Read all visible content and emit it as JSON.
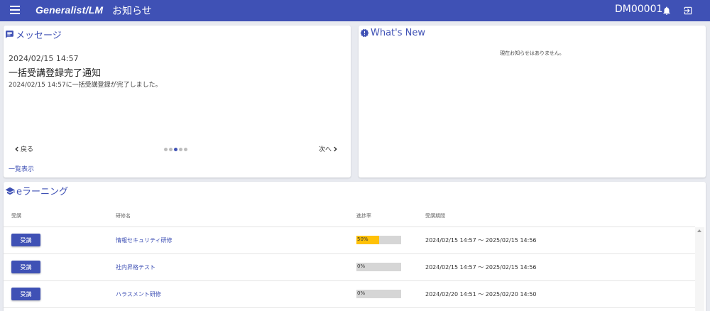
{
  "header": {
    "brand": "Generalist/LM",
    "page_title": "お知らせ",
    "user_id": "DM00001",
    "bar_color": "#3f51b5",
    "icons": [
      "menu-icon",
      "bell-icon",
      "logout-icon"
    ]
  },
  "message_card": {
    "title": "メッセージ",
    "icon": "message-icon",
    "date": "2024/02/15 14:57",
    "subject": "一括受講登録完了通知",
    "body": "2024/02/15 14:57に一括受講登録が完了しました。",
    "prev_label": "戻る",
    "next_label": "次へ",
    "page_count": 5,
    "current_page": 3,
    "list_link": "一覧表示"
  },
  "news_card": {
    "title": "What's New",
    "icon": "alert-icon",
    "empty_text": "現在お知らせはありません。"
  },
  "elearning": {
    "title": "eラーニング",
    "icon": "graduation-cap-icon",
    "columns": [
      "受講",
      "研修名",
      "進捗率",
      "受講期間"
    ],
    "rows": [
      {
        "button": "受講",
        "name": "情報セキュリティ研修",
        "progress_label": "50%",
        "progress": 0.5,
        "period": "2024/02/15 14:57 ～ 2025/02/15 14:56"
      },
      {
        "button": "受講",
        "name": "社内昇格テスト",
        "progress_label": "0%",
        "progress": 0,
        "period": "2024/02/15 14:57 ～ 2025/02/15 14:56"
      },
      {
        "button": "受講",
        "name": "ハラスメント研修",
        "progress_label": "0%",
        "progress": 0,
        "period": "2024/02/20 14:51 ～ 2025/02/20 14:50"
      }
    ],
    "progress_color": "#ffc107"
  }
}
